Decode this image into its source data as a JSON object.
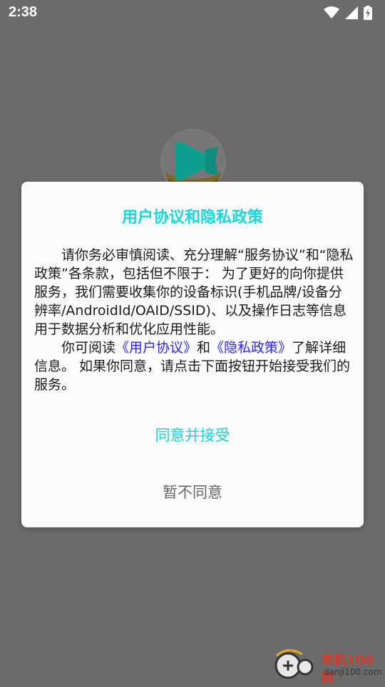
{
  "status_bar": {
    "time": "2:38",
    "icons": [
      "wifi-icon",
      "signal-icon",
      "battery-charging-icon"
    ]
  },
  "dialog": {
    "title": "用户协议和隐私政策",
    "para1": "请你务必审慎阅读、充分理解“服务协议”和“隐私政策”各条款，包括但不限于： 为了更好的向你提供服务，我们需要收集你的设备标识(手机品牌/设备分辨率/AndroidId/OAID/SSID)、以及操作日志等信息用于数据分析和优化应用性能。",
    "para2_prefix": "你可阅读",
    "user_agreement_link": "《用户协议》",
    "para2_and": "和",
    "privacy_policy_link": "《隐私政策》",
    "para2_suffix": "了解详细信息。 如果你同意，请点击下面按钮开始接受我们的服务。",
    "accept_label": "同意并接受",
    "reject_label": "暂不同意"
  },
  "watermark": {
    "title": "单机100网",
    "url": "danji100.com"
  },
  "colors": {
    "accent": "#19d6d9",
    "link": "#2d2ae6",
    "overlay": "#6b6b6b"
  }
}
